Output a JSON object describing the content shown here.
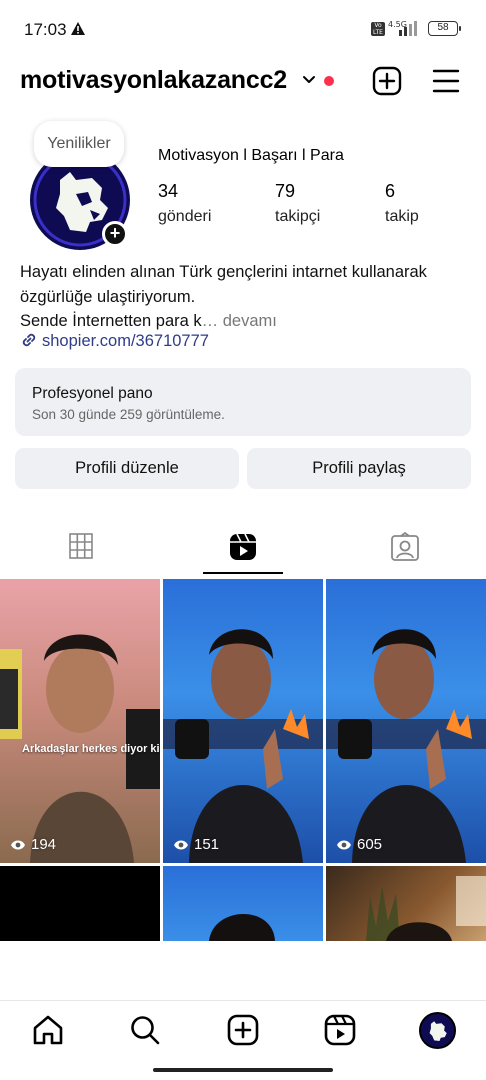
{
  "status_bar": {
    "time": "17:03",
    "volte_label": "Vo LTE",
    "network_label": "4.5G",
    "battery": "58"
  },
  "header": {
    "username": "motivasyonlakazancc2"
  },
  "profile": {
    "note": "Yenilikler",
    "display_name": "Motivasyon l Başarı l Para",
    "stats": [
      {
        "value": "34",
        "label": "gönderi"
      },
      {
        "value": "79",
        "label": "takipçi"
      },
      {
        "value": "6",
        "label": "takip"
      }
    ],
    "bio_lines": [
      "Hayatı elinden alınan Türk gençlerini intarnet kullanarak",
      "özgürlüğe ulaştiriyorum.",
      "Sende İnternetten para k"
    ],
    "bio_more": "… devamı",
    "link": "shopier.com/36710777"
  },
  "dashboard": {
    "title": "Profesyonel pano",
    "subtitle": "Son 30 günde 259 görüntüleme."
  },
  "buttons": {
    "edit": "Profili düzenle",
    "share": "Profili paylaş"
  },
  "tabs": [
    {
      "icon": "grid-icon",
      "active": false
    },
    {
      "icon": "reels-icon",
      "active": true
    },
    {
      "icon": "tagged-icon",
      "active": false
    }
  ],
  "reels": [
    {
      "views": "194",
      "caption": "Arkadaşlar herkes diyor ki"
    },
    {
      "views": "151"
    },
    {
      "views": "605"
    }
  ],
  "nav": [
    "home-icon",
    "search-icon",
    "create-icon",
    "reels-icon",
    "profile-avatar"
  ],
  "colors": {
    "link": "#2e3c8a",
    "notification_dot": "#ff2e4c",
    "panel_bg": "#eff0f3"
  }
}
